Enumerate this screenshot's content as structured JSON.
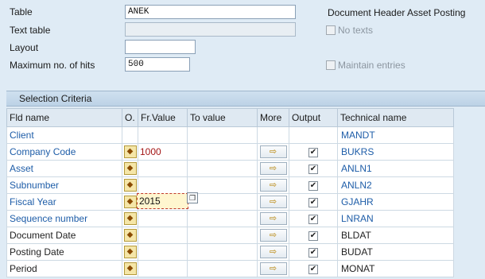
{
  "header": {
    "table_label": "Table",
    "table_value": "ANEK",
    "table_description": "Document Header Asset Posting",
    "text_table_label": "Text table",
    "text_table_value": "",
    "no_texts_label": "No texts",
    "layout_label": "Layout",
    "layout_value": "",
    "max_hits_label": "Maximum no. of hits",
    "max_hits_value": "500",
    "maintain_entries_label": "Maintain entries"
  },
  "selection": {
    "title": "Selection Criteria",
    "columns": {
      "fld_name": "Fld name",
      "op": "O.",
      "fr_value": "Fr.Value",
      "to_value": "To value",
      "more": "More",
      "output": "Output",
      "technical_name": "Technical name"
    },
    "rows": [
      {
        "fld": "Client",
        "tech": "MANDT",
        "key": true,
        "has_controls": false,
        "fr": "",
        "output": false
      },
      {
        "fld": "Company Code",
        "tech": "BUKRS",
        "key": true,
        "has_controls": true,
        "fr": "1000",
        "output": true
      },
      {
        "fld": "Asset",
        "tech": "ANLN1",
        "key": true,
        "has_controls": true,
        "fr": "",
        "output": true
      },
      {
        "fld": "Subnumber",
        "tech": "ANLN2",
        "key": true,
        "has_controls": true,
        "fr": "",
        "output": true
      },
      {
        "fld": "Fiscal Year",
        "tech": "GJAHR",
        "key": true,
        "has_controls": true,
        "fr": "2015",
        "output": true,
        "focused": true
      },
      {
        "fld": "Sequence number",
        "tech": "LNRAN",
        "key": true,
        "has_controls": true,
        "fr": "",
        "output": true
      },
      {
        "fld": "Document Date",
        "tech": "BLDAT",
        "key": false,
        "has_controls": true,
        "fr": "",
        "output": true
      },
      {
        "fld": "Posting Date",
        "tech": "BUDAT",
        "key": false,
        "has_controls": true,
        "fr": "",
        "output": true
      },
      {
        "fld": "Period",
        "tech": "MONAT",
        "key": false,
        "has_controls": true,
        "fr": "",
        "output": true
      }
    ]
  },
  "icons": {
    "operator": "selection-option-icon",
    "more": "multiple-selection-arrow-icon",
    "checked": "checkmark-icon",
    "f4": "value-help-icon"
  },
  "colors": {
    "background": "#dfebf5",
    "key_field_text": "#1e5da8",
    "value_text": "#a31515",
    "focus_border": "#c0392b"
  }
}
